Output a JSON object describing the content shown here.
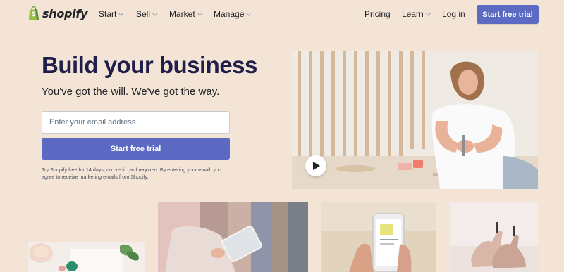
{
  "brand": {
    "name": "shopify",
    "color": "#95bf47"
  },
  "nav": {
    "left_items": [
      {
        "label": "Start",
        "has_dropdown": true
      },
      {
        "label": "Sell",
        "has_dropdown": true
      },
      {
        "label": "Market",
        "has_dropdown": true
      },
      {
        "label": "Manage",
        "has_dropdown": true
      }
    ],
    "right_items": [
      {
        "label": "Pricing",
        "has_dropdown": false
      },
      {
        "label": "Learn",
        "has_dropdown": true
      },
      {
        "label": "Log in",
        "has_dropdown": false
      }
    ],
    "cta_label": "Start free trial"
  },
  "hero": {
    "title": "Build your business",
    "subtitle": "You've got the will. We've got the way.",
    "email_placeholder": "Enter your email address",
    "email_value": "",
    "cta_label": "Start free trial",
    "disclaimer": "Try Shopify free for 14 days, no credit card required. By entering your email, you agree to receive marketing emails from Shopify."
  },
  "video": {
    "play_icon": "play-icon"
  },
  "colors": {
    "accent": "#5c6ac4",
    "background": "#f4e4d6",
    "heading": "#1f1f4a"
  }
}
